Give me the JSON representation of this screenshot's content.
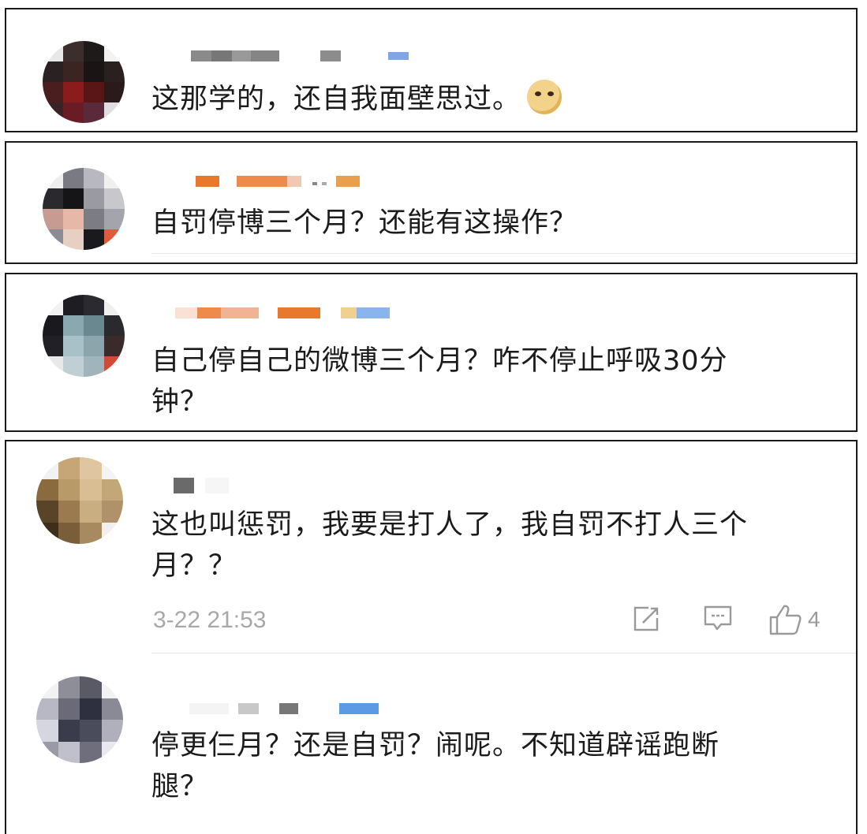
{
  "comments": [
    {
      "text": "这那学的，还自我面壁思过。",
      "emoji": "doge-emoji"
    },
    {
      "text": "自罚停博三个月？还能有这操作？"
    },
    {
      "text": "自己停自己的微博三个月？咋不停止呼吸30分\n钟？"
    },
    {
      "text": "这也叫惩罚，我要是打人了，我自罚不打人三个\n月？？",
      "time": "3-22 21:53",
      "likes": "4"
    },
    {
      "text": "停更仨月？还是自罚？闹呢。不知道辟谣跑断\n腿？"
    }
  ],
  "icons": {
    "share": "share-icon",
    "comment": "comment-icon",
    "like": "thumbs-up-icon"
  },
  "colors": {
    "accent_orange": "#e8782c",
    "vip_blue": "#5b9be6",
    "meta_gray": "#a8a8a8",
    "border": "#1a1a1a"
  }
}
